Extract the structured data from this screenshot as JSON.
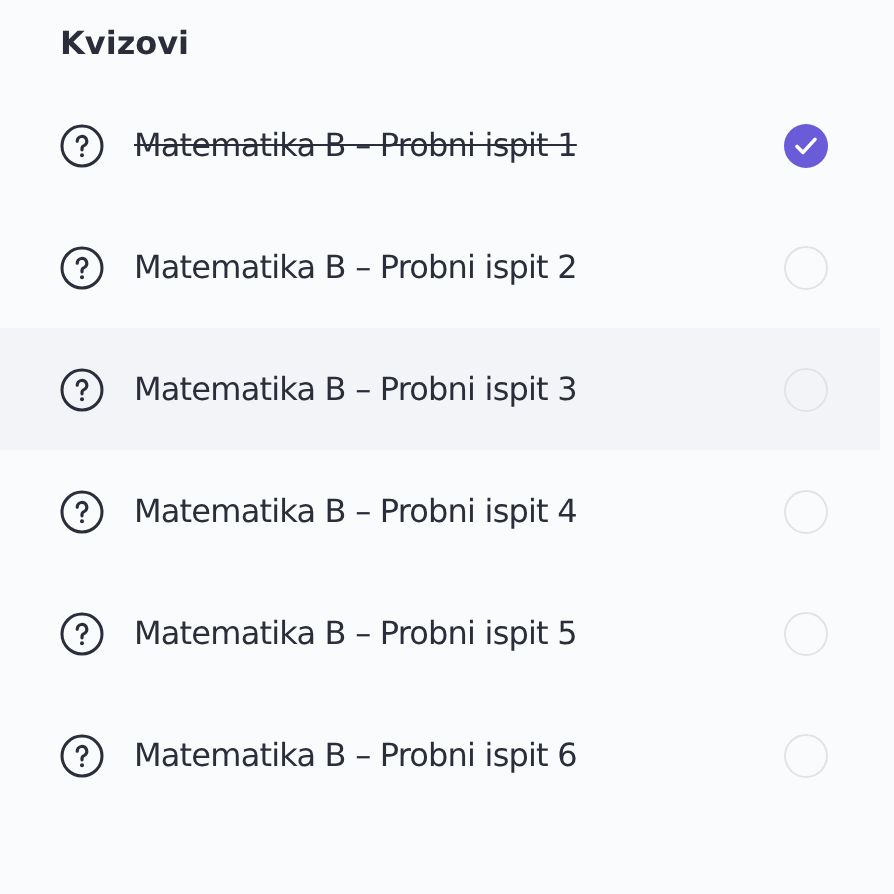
{
  "title": "Kvizovi",
  "quizzes": [
    {
      "label": "Matematika B – Probni ispit 1",
      "checked": true,
      "hovered": false
    },
    {
      "label": "Matematika B – Probni ispit 2",
      "checked": false,
      "hovered": false
    },
    {
      "label": "Matematika B – Probni ispit 3",
      "checked": false,
      "hovered": true
    },
    {
      "label": "Matematika B – Probni ispit 4",
      "checked": false,
      "hovered": false
    },
    {
      "label": "Matematika B – Probni ispit 5",
      "checked": false,
      "hovered": false
    },
    {
      "label": "Matematika B – Probni ispit 6",
      "checked": false,
      "hovered": false
    }
  ]
}
